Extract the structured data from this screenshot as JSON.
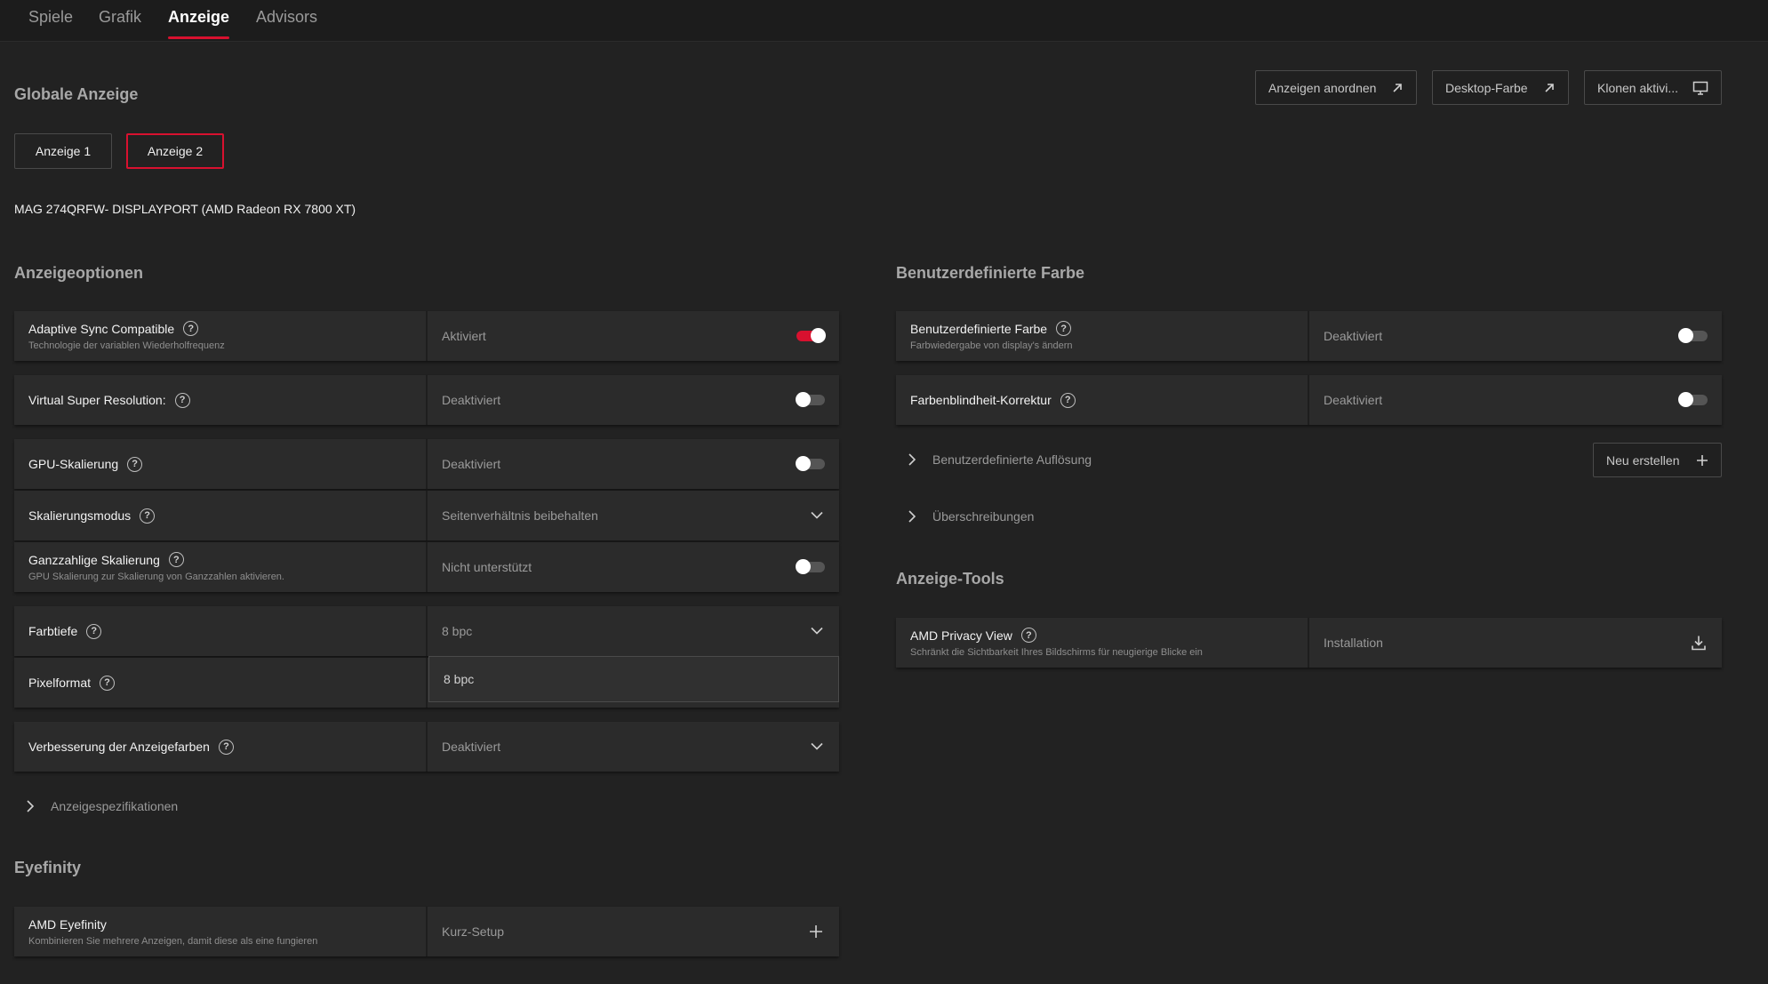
{
  "nav": {
    "tabs": [
      {
        "label": "Spiele"
      },
      {
        "label": "Grafik"
      },
      {
        "label": "Anzeige"
      },
      {
        "label": "Advisors"
      }
    ]
  },
  "global": {
    "title": "Globale Anzeige",
    "actions": {
      "arrange": "Anzeigen anordnen",
      "desktop_color": "Desktop-Farbe",
      "clone": "Klonen aktivi..."
    },
    "displays": [
      "Anzeige 1",
      "Anzeige 2"
    ],
    "selected_display": "Anzeige 2",
    "monitor": "MAG 274QRFW- DISPLAYPORT (AMD Radeon RX 7800 XT)"
  },
  "options": {
    "title": "Anzeigeoptionen",
    "rows": [
      {
        "label": "Adaptive Sync Compatible",
        "sub": "Technologie der variablen Wiederholfrequenz",
        "value": "Aktiviert",
        "control": "toggle",
        "on": true
      },
      {
        "label": "Virtual Super Resolution:",
        "sub": "",
        "value": "Deaktiviert",
        "control": "toggle",
        "on": false
      },
      {
        "label": "GPU-Skalierung",
        "sub": "",
        "value": "Deaktiviert",
        "control": "toggle",
        "on": false
      },
      {
        "label": "Skalierungsmodus",
        "sub": "",
        "value": "Seitenverhältnis beibehalten",
        "control": "dropdown"
      },
      {
        "label": "Ganzzahlige Skalierung",
        "sub": "GPU Skalierung zur Skalierung von Ganzzahlen aktivieren.",
        "value": "Nicht unterstützt",
        "control": "toggle",
        "on": false
      },
      {
        "label": "Farbtiefe",
        "sub": "",
        "value": "8 bpc",
        "control": "dropdown"
      },
      {
        "label": "Pixelformat",
        "sub": "",
        "value": "",
        "control": "none"
      },
      {
        "label": "Verbesserung der Anzeigefarben",
        "sub": "",
        "value": "Deaktiviert",
        "control": "dropdown"
      }
    ],
    "dropdown_option": "8 bpc",
    "specs_label": "Anzeigespezifikationen"
  },
  "eyefinity": {
    "title": "Eyefinity",
    "label": "AMD Eyefinity",
    "sub": "Kombinieren Sie mehrere Anzeigen, damit diese als eine fungieren",
    "value": "Kurz-Setup"
  },
  "custom_color": {
    "title": "Benutzerdefinierte Farbe",
    "rows": [
      {
        "label": "Benutzerdefinierte Farbe",
        "sub": "Farbwiedergabe von display's ändern",
        "value": "Deaktiviert",
        "on": false
      },
      {
        "label": "Farbenblindheit-Korrektur",
        "sub": "",
        "value": "Deaktiviert",
        "on": false
      }
    ],
    "custom_resolution": "Benutzerdefinierte Auflösung",
    "new_button": "Neu erstellen",
    "overrides": "Überschreibungen"
  },
  "tools": {
    "title": "Anzeige-Tools",
    "label": "AMD Privacy View",
    "sub": "Schränkt die Sichtbarkeit Ihres Bildschirms für neugierige Blicke ein",
    "value": "Installation"
  },
  "colors": {
    "accent": "#d8112f",
    "background": "#222222",
    "panel": "#2b2b2b"
  }
}
